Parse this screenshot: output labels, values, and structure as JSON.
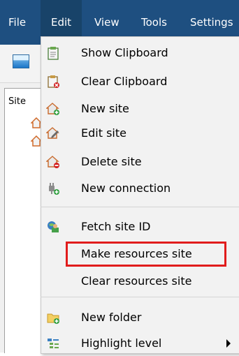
{
  "menubar": {
    "items": [
      {
        "label": "File"
      },
      {
        "label": "Edit"
      },
      {
        "label": "View"
      },
      {
        "label": "Tools"
      },
      {
        "label": "Settings"
      }
    ],
    "active_item": "Edit",
    "bg_color": "#1e4f80"
  },
  "side_panel": {
    "label": "Site"
  },
  "edit_menu": {
    "items": [
      {
        "label": "Show Clipboard",
        "icon": "clipboard-icon"
      },
      {
        "label": "Clear Clipboard",
        "icon": "clear-clipboard-icon"
      },
      {
        "label": "New site",
        "icon": "new-site-icon"
      },
      {
        "label": "Edit site",
        "icon": "edit-site-icon"
      },
      {
        "label": "Delete site",
        "icon": "delete-site-icon"
      },
      {
        "label": "New connection",
        "icon": "new-connection-icon"
      },
      {
        "label": "Fetch site ID",
        "icon": "fetch-site-id-icon"
      },
      {
        "label": "Make resources site",
        "icon": "",
        "highlighted": true
      },
      {
        "label": "Clear resources site",
        "icon": ""
      },
      {
        "label": "New folder",
        "icon": "new-folder-icon"
      },
      {
        "label": "Highlight level",
        "icon": "highlight-level-icon",
        "has_submenu": true
      }
    ],
    "highlight_color": "#e11c1c"
  }
}
